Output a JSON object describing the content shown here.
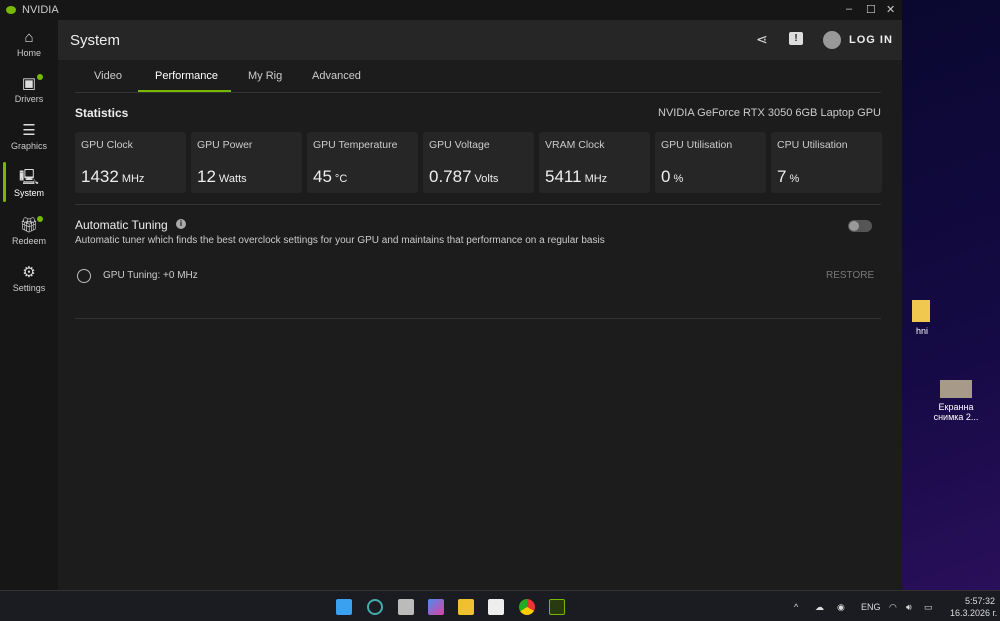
{
  "app": {
    "title": "NVIDIA",
    "window_controls": [
      "–",
      "☐",
      "✕"
    ]
  },
  "sidebar": {
    "items": [
      {
        "label": "Home",
        "icon": "home-icon",
        "badge": false
      },
      {
        "label": "Drivers",
        "icon": "drivers-icon",
        "badge": true
      },
      {
        "label": "Graphics",
        "icon": "sliders-icon",
        "badge": false
      },
      {
        "label": "System",
        "icon": "system-icon",
        "badge": false,
        "active": true
      },
      {
        "label": "Redeem",
        "icon": "gift-icon",
        "badge": true
      },
      {
        "label": "Settings",
        "icon": "gear-icon",
        "badge": false
      }
    ]
  },
  "header": {
    "title": "System",
    "login_label": "LOG IN"
  },
  "tabs": [
    {
      "label": "Video"
    },
    {
      "label": "Performance",
      "active": true
    },
    {
      "label": "My Rig"
    },
    {
      "label": "Advanced"
    }
  ],
  "statistics": {
    "title": "Statistics",
    "gpu_name": "NVIDIA GeForce RTX 3050 6GB Laptop GPU",
    "cards": [
      {
        "label": "GPU Clock",
        "value": "1432",
        "unit": "MHz"
      },
      {
        "label": "GPU Power",
        "value": "12",
        "unit": "Watts"
      },
      {
        "label": "GPU Temperature",
        "value": "45",
        "unit": "°C"
      },
      {
        "label": "GPU Voltage",
        "value": "0.787",
        "unit": "Volts"
      },
      {
        "label": "VRAM Clock",
        "value": "5411",
        "unit": "MHz"
      },
      {
        "label": "GPU Utilisation",
        "value": "0",
        "unit": "%"
      },
      {
        "label": "CPU Utilisation",
        "value": "7",
        "unit": "%"
      }
    ]
  },
  "tuning": {
    "title": "Automatic Tuning",
    "description": "Automatic tuner which finds the best overclock settings for your GPU and maintains that performance on a regular basis",
    "enabled": false,
    "gpu_tuning": "GPU Tuning: +0 MHz",
    "restore_label": "RESTORE"
  },
  "desktop": {
    "icons": [
      {
        "label": "hni"
      },
      {
        "label": "Екранна снимка 2..."
      }
    ]
  },
  "taskbar": {
    "lang": "ENG",
    "time": "5:57:32",
    "date": "16.3.2026 г."
  }
}
